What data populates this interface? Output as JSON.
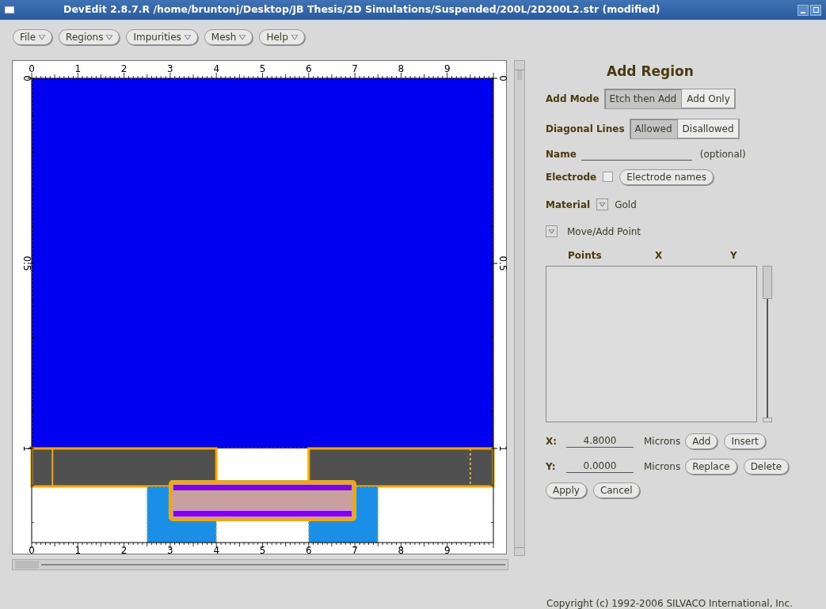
{
  "window": {
    "title": "DevEdit 2.8.7.R /home/bruntonj/Desktop/JB Thesis/2D Simulations/Suspended/200L/2D200L2.str (modified)"
  },
  "menus": [
    {
      "label": "File"
    },
    {
      "label": "Regions"
    },
    {
      "label": "Impurities"
    },
    {
      "label": "Mesh"
    },
    {
      "label": "Help"
    }
  ],
  "canvas": {
    "top_ticks": [
      "0",
      "1",
      "2",
      "3",
      "4",
      "5",
      "6",
      "7",
      "8",
      "9"
    ],
    "bottom_ticks": [
      "0",
      "1",
      "2",
      "3",
      "4",
      "5",
      "6",
      "7",
      "8",
      "9"
    ],
    "left_ticks": [
      "0",
      "0.5",
      "1"
    ],
    "right_ticks": [
      "0",
      "0.5",
      "1"
    ]
  },
  "panel": {
    "title": "Add Region",
    "add_mode": {
      "label": "Add Mode",
      "options": [
        {
          "label": "Etch then Add",
          "selected": true
        },
        {
          "label": "Add Only",
          "selected": false
        }
      ]
    },
    "diagonal_lines": {
      "label": "Diagonal Lines",
      "options": [
        {
          "label": "Allowed",
          "selected": true
        },
        {
          "label": "Disallowed",
          "selected": false
        }
      ]
    },
    "name": {
      "label": "Name",
      "hint": "(optional)"
    },
    "electrode": {
      "label": "Electrode",
      "checked": false,
      "button": "Electrode names"
    },
    "material": {
      "label": "Material",
      "value": "Gold"
    },
    "point_mode": {
      "label": "Move/Add Point"
    },
    "points": {
      "columns": [
        "Points",
        "X",
        "Y"
      ]
    },
    "x": {
      "label": "X:",
      "value": "4.8000",
      "unit": "Microns",
      "buttons": [
        "Add",
        "Insert"
      ]
    },
    "y": {
      "label": "Y:",
      "value": "0.0000",
      "unit": "Microns",
      "buttons": [
        "Replace",
        "Delete"
      ]
    },
    "actions": [
      "Apply",
      "Cancel"
    ]
  },
  "copyright": "Copyright (c) 1992-2006 SILVACO International, Inc."
}
